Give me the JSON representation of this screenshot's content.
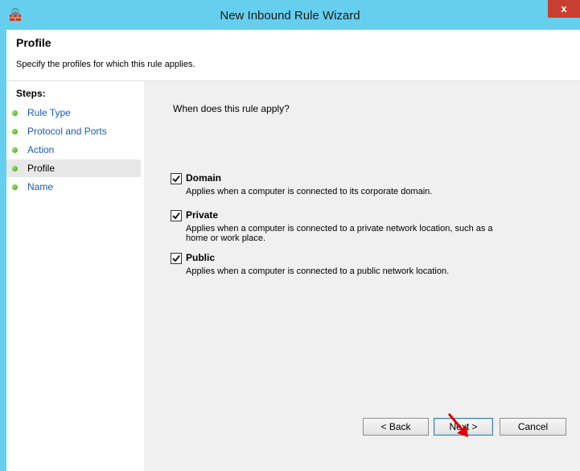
{
  "window": {
    "title": "New Inbound Rule Wizard",
    "close_label": "x"
  },
  "header": {
    "title": "Profile",
    "subtitle": "Specify the profiles for which this rule applies."
  },
  "steps": {
    "heading": "Steps:",
    "items": [
      {
        "label": "Rule Type",
        "current": false
      },
      {
        "label": "Protocol and Ports",
        "current": false
      },
      {
        "label": "Action",
        "current": false
      },
      {
        "label": "Profile",
        "current": true
      },
      {
        "label": "Name",
        "current": false
      }
    ]
  },
  "main": {
    "question": "When does this rule apply?",
    "options": [
      {
        "label": "Domain",
        "description": "Applies when a computer is connected to its corporate domain.",
        "checked": true
      },
      {
        "label": "Private",
        "description": "Applies when a computer is connected to a private network location, such as a home or work place.",
        "checked": true
      },
      {
        "label": "Public",
        "description": "Applies when a computer is connected to a public network location.",
        "checked": true
      }
    ]
  },
  "buttons": {
    "back": "< Back",
    "next": "Next >",
    "cancel": "Cancel"
  },
  "colors": {
    "titlebar": "#66cfee",
    "close": "#c94032",
    "link": "#1a5bb5",
    "annotation_arrow": "#e00000"
  }
}
